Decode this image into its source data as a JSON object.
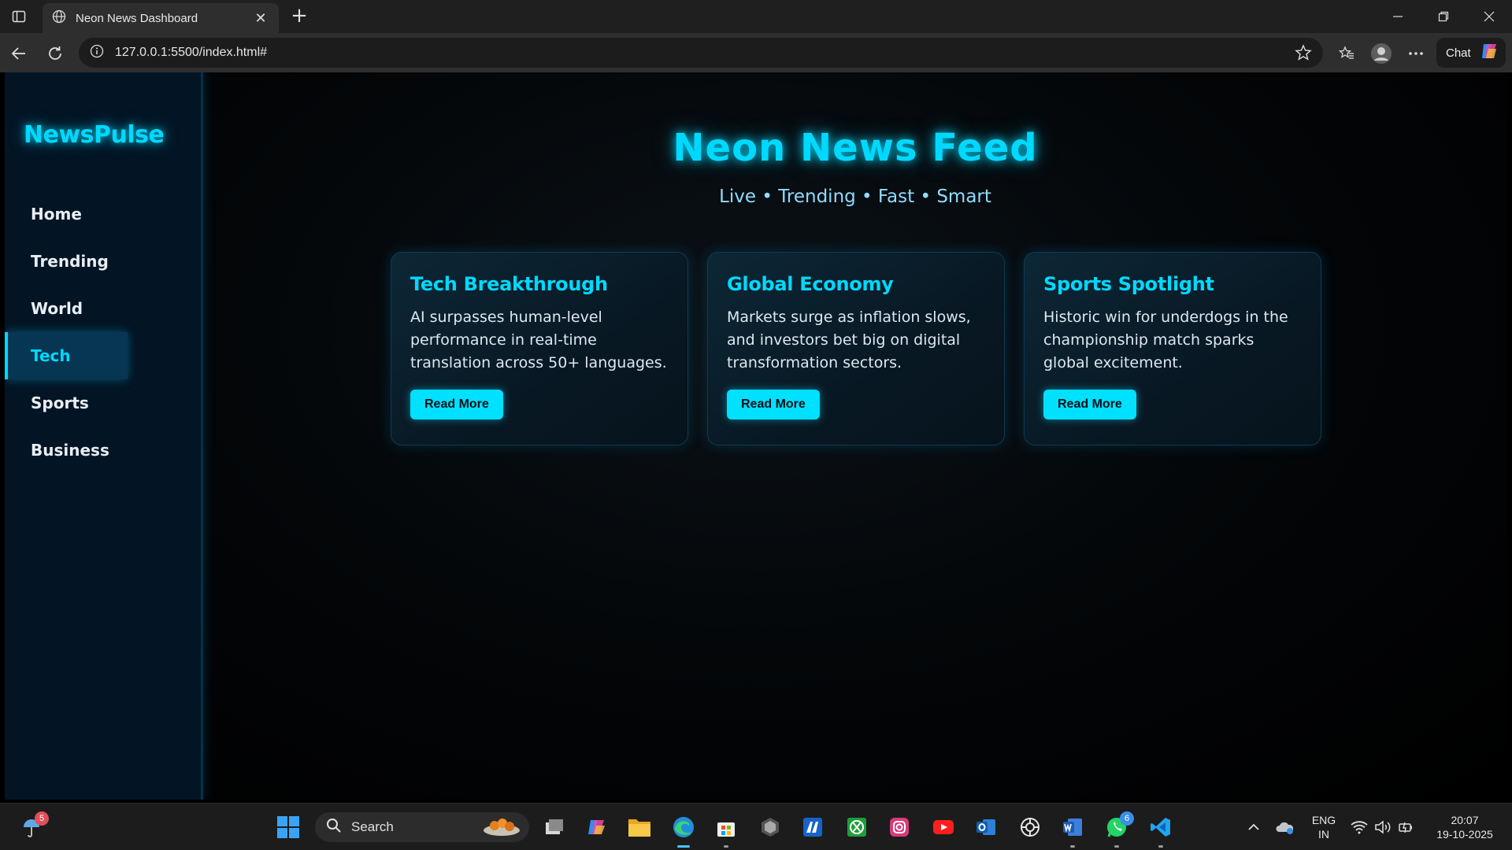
{
  "browser": {
    "tab_title": "Neon News Dashboard",
    "url": "127.0.0.1:5500/index.html#",
    "chat_label": "Chat"
  },
  "sidebar": {
    "brand": "NewsPulse",
    "items": [
      {
        "label": "Home",
        "active": false
      },
      {
        "label": "Trending",
        "active": false
      },
      {
        "label": "World",
        "active": false
      },
      {
        "label": "Tech",
        "active": true
      },
      {
        "label": "Sports",
        "active": false
      },
      {
        "label": "Business",
        "active": false
      }
    ]
  },
  "main": {
    "headline": "Neon News Feed",
    "tagline": "Live • Trending • Fast • Smart",
    "cards": [
      {
        "title": "Tech Breakthrough",
        "text": "AI surpasses human-level performance in real-time translation across 50+ languages.",
        "button": "Read More"
      },
      {
        "title": "Global Economy",
        "text": "Markets surge as inflation slows, and investors bet big on digital transformation sectors.",
        "button": "Read More"
      },
      {
        "title": "Sports Spotlight",
        "text": "Historic win for underdogs in the championship match sparks global excitement.",
        "button": "Read More"
      }
    ]
  },
  "taskbar": {
    "search_label": "Search",
    "weather_badge": "5",
    "whatsapp_badge": "6",
    "language_line1": "ENG",
    "language_line2": "IN",
    "time": "20:07",
    "date": "19-10-2025"
  },
  "colors": {
    "accent": "#00d9ff",
    "sidebar_bg": "#031424",
    "card_bg": "#0a1f2c"
  }
}
